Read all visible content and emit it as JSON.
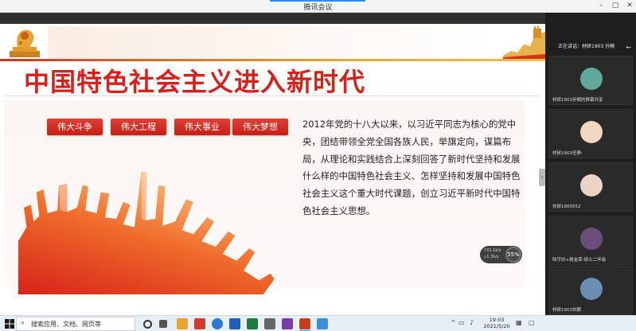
{
  "window": {
    "title": "腾讯会议",
    "controls": [
      "–",
      "□",
      "✕"
    ]
  },
  "slide": {
    "title": "中国特色社会主义进入新时代",
    "tags": [
      "伟大斗争",
      "伟大工程",
      "伟大事业",
      "伟大梦想"
    ],
    "body": "2012年党的十八大以来，以习近平同志为核心的党中央，团结带领全党全国各族人民，举旗定向，谋篇布局，从理论和实践结合上深刻回答了新时代坚持和发展什么样的中国特色社会主义、怎样坚持和发展中国特色社会主义这个重大时代课题，创立习近平新时代中国特色社会主义思想。",
    "net": {
      "up": "↑51.1k/s",
      "down": "↓1.7k/s",
      "percent": "55%"
    }
  },
  "panel": {
    "speaking": "正在讲话：材研1903 孙楠",
    "participants": [
      {
        "name": "材研1903孙楠的屏幕共享",
        "color": "#5fa89a"
      },
      {
        "name": "材研1903任静-",
        "color": "#f2d8c0"
      },
      {
        "name": "刘研1900552",
        "color": "#e9d4c5"
      },
      {
        "name": "陆宇欣+赖金荣-硕士二年级",
        "color": "#6b4e7a"
      },
      {
        "name": "材研1903刘娜",
        "color": "#6a8fb3"
      }
    ]
  },
  "taskbar": {
    "search_placeholder": "搜索应用、文档、网页等",
    "time": "19:03",
    "date": "2021/5/20",
    "icon_colors": [
      "#555",
      "#555",
      "#4f8dd6",
      "#d13b2b",
      "#2a78d3",
      "#1f7bc7",
      "#1f7a3e",
      "#444",
      "#7a3ca5",
      "#c43e1c",
      "#3b8ed8"
    ]
  }
}
